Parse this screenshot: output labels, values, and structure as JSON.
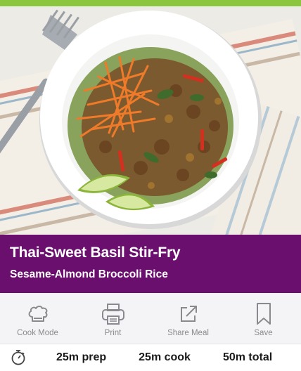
{
  "colors": {
    "top_bar": "#8cc63f",
    "title_band": "#6b0f6e",
    "action_bar": "#f4f4f6",
    "action_text": "#8a8a8e"
  },
  "hero": {
    "icon": "photo"
  },
  "recipe": {
    "title": "Thai-Sweet Basil Stir-Fry",
    "subtitle": "Sesame-Almond Broccoli Rice"
  },
  "actions": [
    {
      "label": "Cook Mode",
      "icon": "chef-hat-icon"
    },
    {
      "label": "Print",
      "icon": "printer-icon"
    },
    {
      "label": "Share Meal",
      "icon": "share-icon"
    },
    {
      "label": "Save",
      "icon": "bookmark-icon"
    }
  ],
  "times": {
    "icon": "stopwatch-icon",
    "prep": "25m prep",
    "cook": "25m cook",
    "total": "50m total"
  }
}
